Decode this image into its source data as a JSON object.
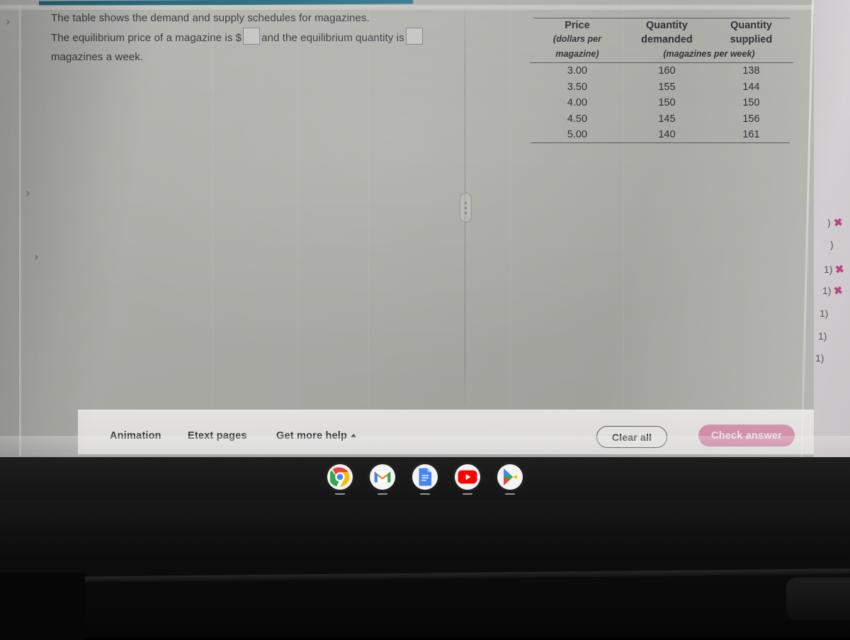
{
  "question": {
    "line1": "The table shows the demand and supply schedules for magazines.",
    "line2_before_blank": "The equilibrium price of a magazine is $",
    "line2_mid": "and the equilibrium quantity is",
    "line3": "magazines a week.",
    "blank1_value": "",
    "blank2_value": ""
  },
  "table": {
    "headers": {
      "price": "Price",
      "price_unit_l1": "(dollars per",
      "price_unit_l2": "magazine)",
      "quantity_demanded_l1": "Quantity",
      "quantity_demanded_l2": "demanded",
      "quantity_supplied_l1": "Quantity",
      "quantity_supplied_l2": "supplied",
      "quantity_unit": "(magazines per week)"
    },
    "rows": [
      {
        "price": "3.00",
        "demanded": "160",
        "supplied": "138"
      },
      {
        "price": "3.50",
        "demanded": "155",
        "supplied": "144"
      },
      {
        "price": "4.00",
        "demanded": "150",
        "supplied": "150"
      },
      {
        "price": "4.50",
        "demanded": "145",
        "supplied": "156"
      },
      {
        "price": "5.00",
        "demanded": "140",
        "supplied": "161"
      }
    ]
  },
  "toolbar": {
    "animation_label": "Animation",
    "etext_label": "Etext pages",
    "get_more_help_label": "Get more help",
    "clear_all_label": "Clear all",
    "check_answer_label": "Check answer",
    "check_answer_color": "#d07fa1"
  },
  "right_panel": {
    "items": [
      {
        "text": ")",
        "has_x": true
      },
      {
        "text": ")",
        "has_x": false
      },
      {
        "text": "1)",
        "has_x": true
      },
      {
        "text": "1)",
        "has_x": true
      },
      {
        "text": "1)",
        "has_x": false
      },
      {
        "text": "1)",
        "has_x": false
      },
      {
        "text": "1)",
        "has_x": false
      }
    ],
    "x_color": "#b9357a"
  },
  "chevrons": [
    {
      "glyph": "›"
    },
    {
      "glyph": "›"
    },
    {
      "glyph": "›"
    }
  ],
  "shelf": {
    "apps": [
      {
        "name": "chrome-icon"
      },
      {
        "name": "gmail-icon"
      },
      {
        "name": "google-docs-icon"
      },
      {
        "name": "youtube-icon"
      },
      {
        "name": "play-store-icon"
      }
    ]
  },
  "accent": {
    "top_bar_color": "#1d6278",
    "input_border": "#6f7f95"
  }
}
